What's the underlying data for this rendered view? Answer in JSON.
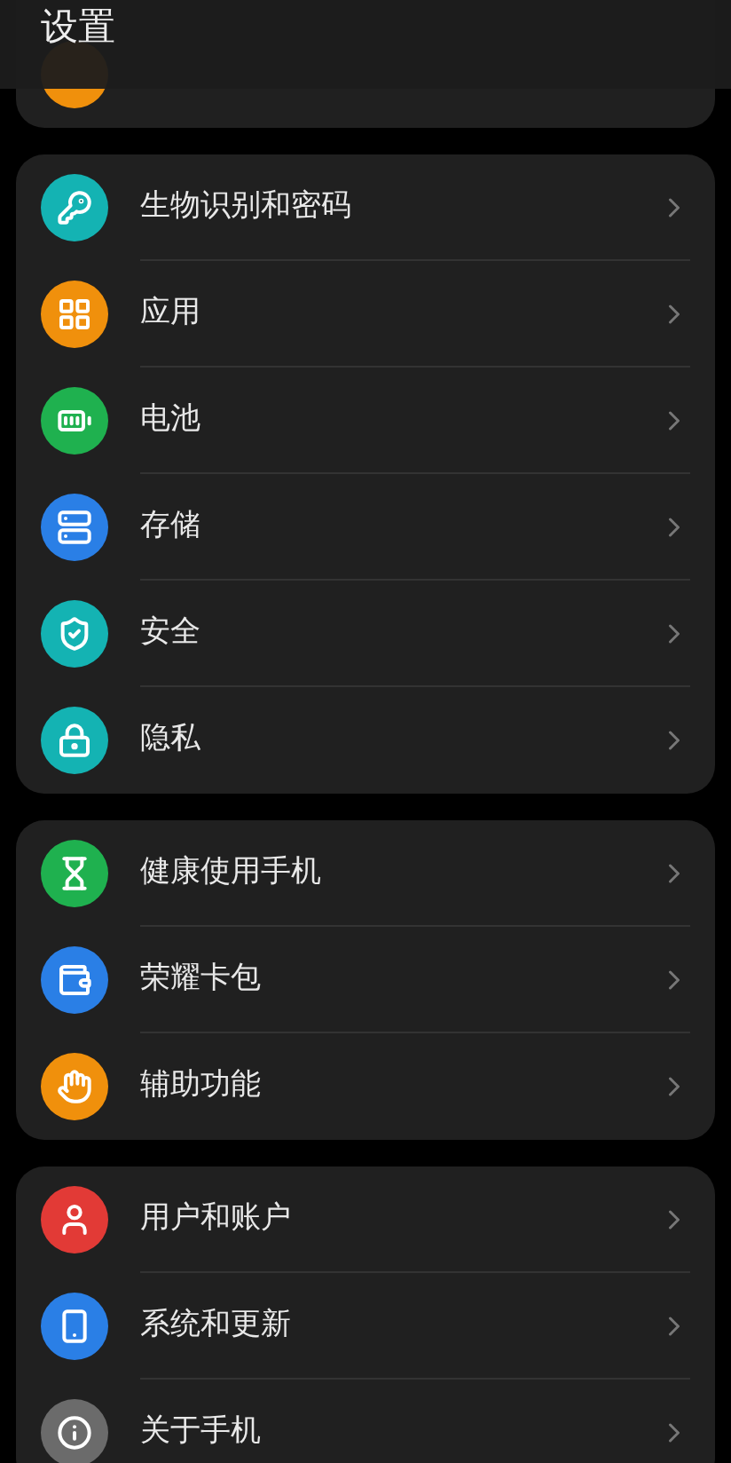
{
  "header": {
    "title": "设置"
  },
  "partial_item": {
    "color": "#f0900c"
  },
  "groups": [
    {
      "items": [
        {
          "kind": "key",
          "label": "生物识别和密码",
          "color": "#14b3b3"
        },
        {
          "kind": "apps",
          "label": "应用",
          "color": "#f0900c"
        },
        {
          "kind": "battery",
          "label": "电池",
          "color": "#1fb14f"
        },
        {
          "kind": "storage",
          "label": "存储",
          "color": "#2a7fe6"
        },
        {
          "kind": "shield",
          "label": "安全",
          "color": "#14b3b3"
        },
        {
          "kind": "lock",
          "label": "隐私",
          "color": "#14b3b3"
        }
      ]
    },
    {
      "items": [
        {
          "kind": "hourglass",
          "label": "健康使用手机",
          "color": "#1fb14f"
        },
        {
          "kind": "wallet",
          "label": "荣耀卡包",
          "color": "#2a7fe6"
        },
        {
          "kind": "hand",
          "label": "辅助功能",
          "color": "#f0900c"
        }
      ]
    },
    {
      "items": [
        {
          "kind": "user",
          "label": "用户和账户",
          "color": "#e23a36"
        },
        {
          "kind": "phone",
          "label": "系统和更新",
          "color": "#2a7fe6"
        },
        {
          "kind": "info",
          "label": "关于手机",
          "color": "#6b6b6b"
        }
      ]
    }
  ]
}
